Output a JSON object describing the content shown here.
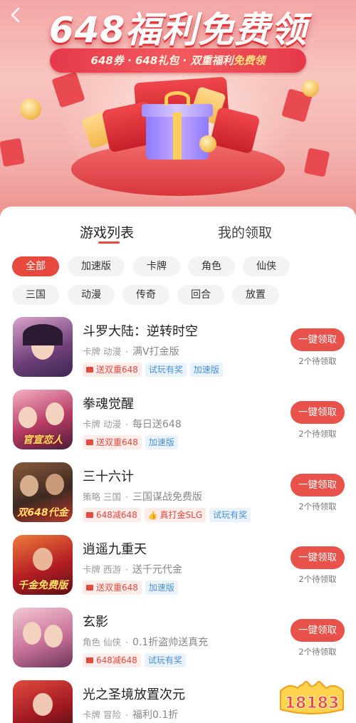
{
  "banner": {
    "back_icon": "chevron-left-icon",
    "title": "648福利免费领",
    "subtitle_a": "648券 · 648礼包 · 双重福利",
    "subtitle_b": "免费领"
  },
  "tabs": [
    {
      "label": "游戏列表",
      "active": true
    },
    {
      "label": "我的领取",
      "active": false
    }
  ],
  "filters": [
    {
      "label": "全部",
      "active": true
    },
    {
      "label": "加速版"
    },
    {
      "label": "卡牌"
    },
    {
      "label": "角色"
    },
    {
      "label": "仙侠"
    },
    {
      "label": "三国"
    },
    {
      "label": "动漫"
    },
    {
      "label": "传奇"
    },
    {
      "label": "回合"
    },
    {
      "label": "放置"
    }
  ],
  "games": [
    {
      "name": "斗罗大陆：逆转时空",
      "cat1": "卡牌",
      "cat2": "动漫",
      "desc": "满V打金版",
      "tags": [
        {
          "text": "送双重648",
          "style": "red"
        },
        {
          "text": "试玩有奖",
          "style": "blue"
        },
        {
          "text": "加速版",
          "style": "blue"
        }
      ],
      "icon_caption": "",
      "claim_label": "一键领取",
      "pending": "2个待领取"
    },
    {
      "name": "拳魂觉醒",
      "cat1": "卡牌",
      "cat2": "动漫",
      "desc": "每日送648",
      "tags": [
        {
          "text": "送双重648",
          "style": "red"
        },
        {
          "text": "加速版",
          "style": "blue"
        }
      ],
      "icon_caption": "官宣恋人",
      "claim_label": "一键领取",
      "pending": "2个待领取"
    },
    {
      "name": "三十六计",
      "cat1": "策略",
      "cat2": "三国",
      "desc": "三国谋战免费版",
      "tags": [
        {
          "text": "648减648",
          "style": "red"
        },
        {
          "text": "真打金SLG",
          "style": "red"
        },
        {
          "text": "试玩有奖",
          "style": "blue"
        }
      ],
      "icon_caption": "双648代金",
      "claim_label": "一键领取",
      "pending": "2个待领取"
    },
    {
      "name": "逍遥九重天",
      "cat1": "卡牌",
      "cat2": "西游",
      "desc": "送千元代金",
      "tags": [
        {
          "text": "送双重648",
          "style": "red"
        },
        {
          "text": "加速版",
          "style": "blue"
        }
      ],
      "icon_caption": "千金免费版",
      "claim_label": "一键领取",
      "pending": "2个待领取"
    },
    {
      "name": "玄影",
      "cat1": "角色",
      "cat2": "仙侠",
      "desc": "0.1折盗帅送真充",
      "tags": [
        {
          "text": "648减648",
          "style": "red"
        },
        {
          "text": "试玩有奖",
          "style": "blue"
        }
      ],
      "icon_caption": "",
      "claim_label": "一键领取",
      "pending": "2个待领取"
    },
    {
      "name": "光之圣境放置次元",
      "cat1": "卡牌",
      "cat2": "冒险",
      "desc": "福利0.1折",
      "tags": [],
      "icon_caption": "",
      "claim_label": "",
      "pending": ""
    }
  ],
  "watermark": {
    "text": "18183"
  },
  "colors": {
    "accent": "#e8493f",
    "claim_button": "#e8524a",
    "tag_red_bg": "#fdecea",
    "tag_blue_bg": "#eaf3fc",
    "tag_blue_text": "#4a8fd6"
  }
}
